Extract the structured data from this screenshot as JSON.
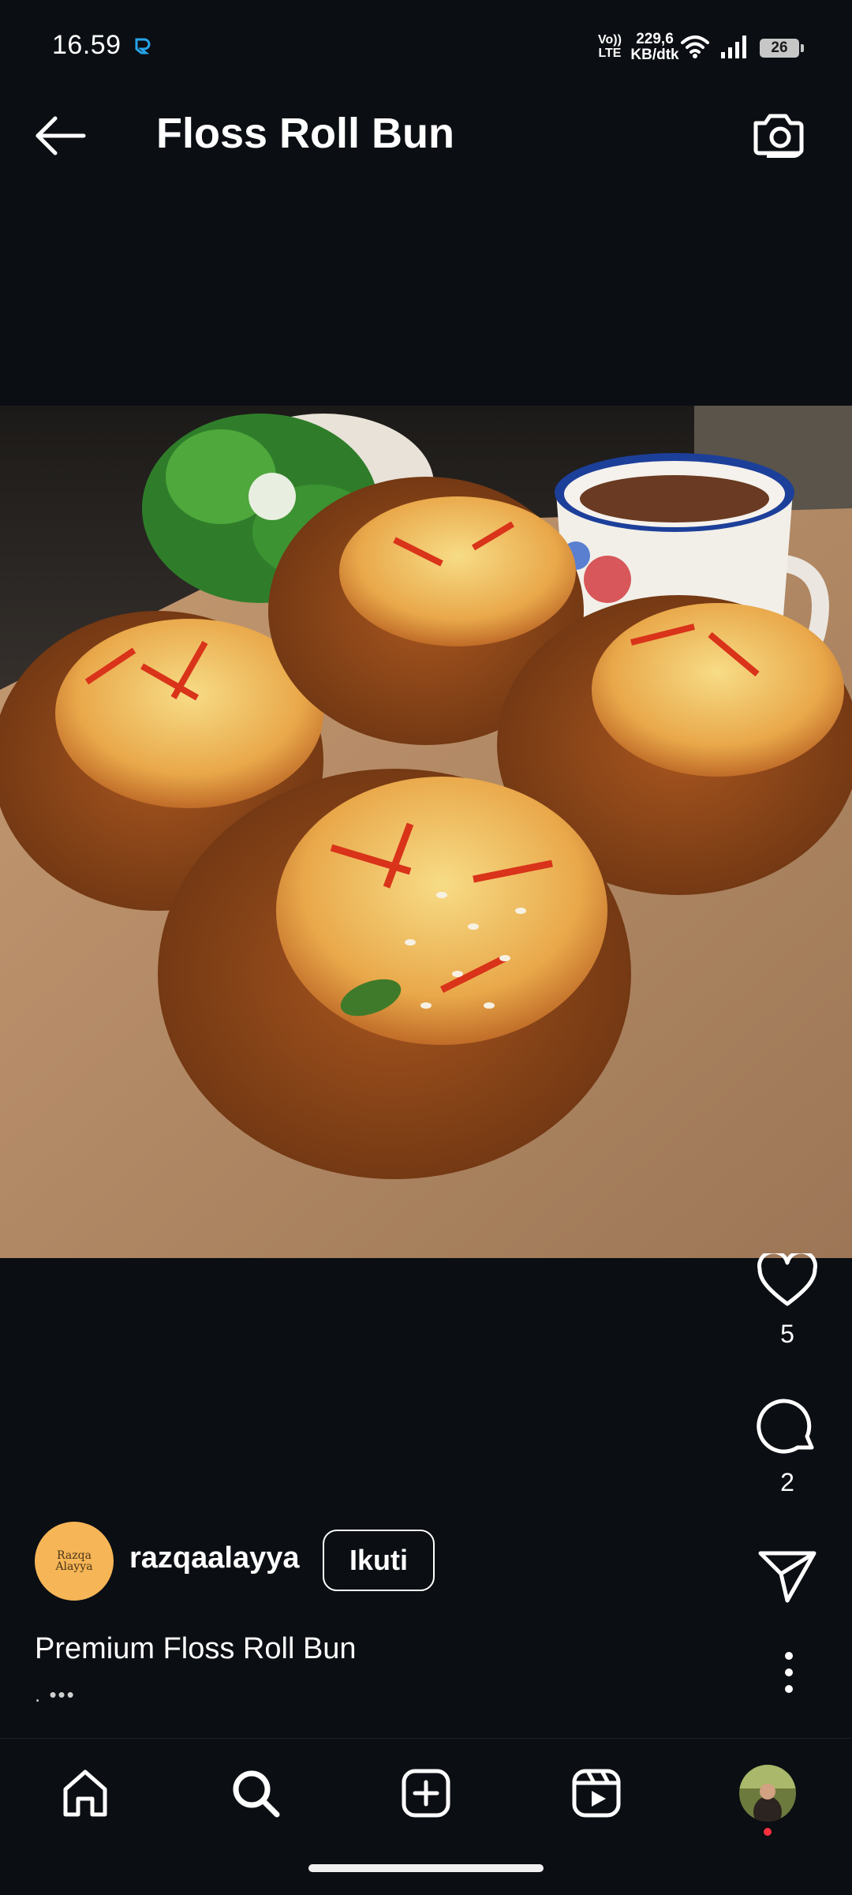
{
  "status_bar": {
    "time": "16.59",
    "notification_icon": "app-notification-icon",
    "volte_line1": "Vo))",
    "volte_line2": "LTE",
    "speed_value": "229,6",
    "speed_unit": "KB/dtk",
    "wifi_icon": "wifi-icon",
    "signal_icon": "signal-icon",
    "battery": "26"
  },
  "header": {
    "back_icon": "back-arrow-icon",
    "title": "Floss Roll Bun",
    "camera_icon": "camera-icon"
  },
  "post": {
    "image_description_icon": "food-photo",
    "likes": "5",
    "comments": "2",
    "author": {
      "avatar_line1": "Razqa",
      "avatar_line2": "Alayya",
      "username": "razqaalayya"
    },
    "follow_label": "Ikuti",
    "caption": "Premium Floss Roll Bun",
    "caption_more": ". •••"
  },
  "nav": {
    "items": [
      "home-icon",
      "search-icon",
      "create-icon",
      "reels-icon",
      "profile-avatar"
    ]
  },
  "colors": {
    "background": "#0b0e13",
    "accent_avatar": "#f6b556",
    "notification_dot": "#ff3040",
    "notification_icon": "#27a4e8"
  }
}
